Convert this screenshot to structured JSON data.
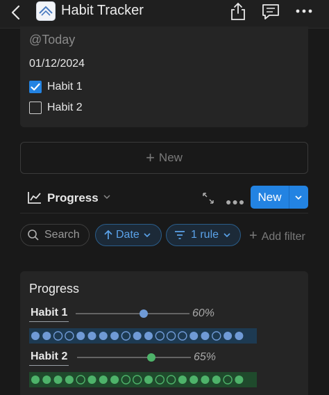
{
  "app": {
    "title": "Habit Tracker"
  },
  "topbar": {
    "back_icon": "chevron-left-icon",
    "share_icon": "share-icon",
    "comment_icon": "comment-icon",
    "more_icon": "more-horizontal-icon"
  },
  "entry": {
    "today": "@Today",
    "date": "01/12/2024",
    "habits": [
      {
        "label": "Habit 1",
        "checked": true
      },
      {
        "label": "Habit 2",
        "checked": false
      }
    ]
  },
  "new_row": {
    "label": "New"
  },
  "view": {
    "name": "Progress",
    "new_label": "New"
  },
  "filters": {
    "search": "Search",
    "date": "Date",
    "rule": "1 rule",
    "add": "Add filter"
  },
  "progress": {
    "title": "Progress",
    "colors": {
      "habit1": "#6f9ad6",
      "habit2": "#4eb36a"
    },
    "items": [
      {
        "label": "Habit 1",
        "percent": "60%",
        "value": 0.6,
        "days": [
          1,
          1,
          0,
          0,
          1,
          1,
          1,
          1,
          0,
          1,
          1,
          0,
          0,
          0,
          1,
          1,
          0,
          1,
          1
        ]
      },
      {
        "label": "Habit 2",
        "percent": "65%",
        "value": 0.65,
        "days": [
          1,
          1,
          1,
          1,
          0,
          1,
          1,
          1,
          0,
          0,
          1,
          0,
          0,
          1,
          1,
          1,
          1,
          0,
          1
        ]
      }
    ]
  }
}
